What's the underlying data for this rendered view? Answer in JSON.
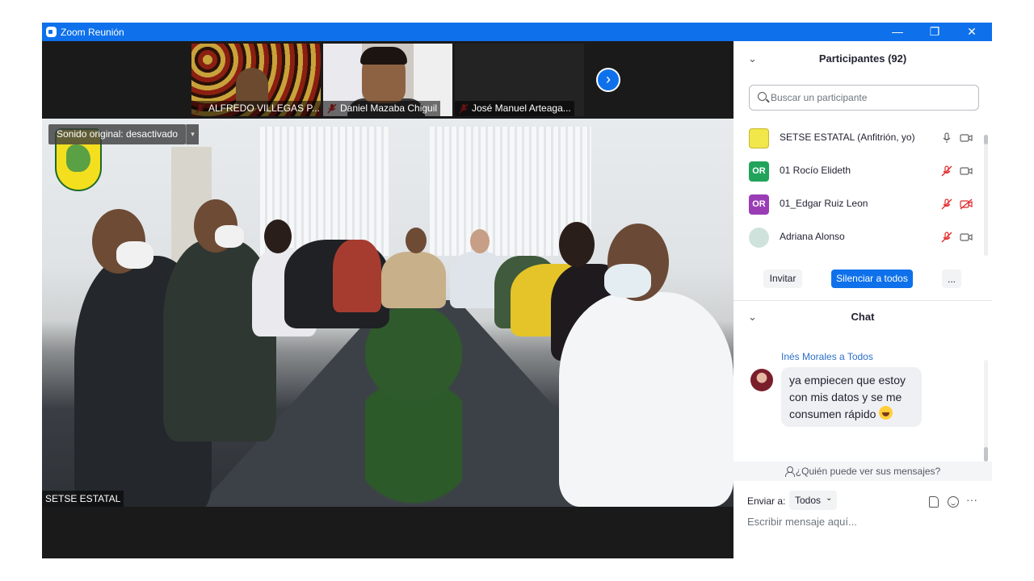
{
  "window": {
    "title": "Zoom Reunión",
    "controls": {
      "minimize": "—",
      "maximize": "❐",
      "close": "✕"
    },
    "accent": "#0e71eb"
  },
  "video_strip": {
    "thumbnails": [
      {
        "name": "ALFREDO VILLEGAS P...",
        "muted": true
      },
      {
        "name": "Daniel Mazaba Chiguil",
        "muted": true
      },
      {
        "name": "José Manuel Arteaga...",
        "muted": true
      }
    ],
    "next_icon": "›"
  },
  "main_video": {
    "audio_badge": "Sonido original: desactivado",
    "dropdown_icon": "▾",
    "speaker_name": "SETSE ESTATAL"
  },
  "participants": {
    "collapse_icon": "⌄",
    "title": "Participantes (92)",
    "search_placeholder": "Buscar un participante",
    "list": [
      {
        "name": "SETSE ESTATAL (Anfitrión, yo)",
        "avatar": "",
        "avatar_color": "#f1e64a",
        "mic": "on",
        "video": "on"
      },
      {
        "name": "01 Rocío Elideth",
        "avatar": "OR",
        "avatar_color": "#22a35c",
        "mic": "muted",
        "video": "on"
      },
      {
        "name": "01_Edgar Ruiz Leon",
        "avatar": "OR",
        "avatar_color": "#9a3db5",
        "mic": "muted",
        "video": "off"
      },
      {
        "name": "Adriana Alonso",
        "avatar": "",
        "avatar_color": "#cfe3dc",
        "mic": "muted",
        "video": "on"
      },
      {
        "name": "",
        "avatar": "",
        "avatar_color": "#9a3db5",
        "mic": "muted",
        "video": "on"
      }
    ],
    "buttons": {
      "invite": "Invitar",
      "mute_all": "Silenciar a todos",
      "more": "..."
    }
  },
  "chat": {
    "collapse_icon": "⌄",
    "title": "Chat",
    "messages": [
      {
        "sender": "Inés Morales a Todos",
        "text": "ya empiecen que estoy con mis datos y se me consumen rápido",
        "emoji": "grinning-face-icon"
      }
    ],
    "privacy_link": "¿Quién puede ver sus mensajes?",
    "send_to_label": "Enviar a:",
    "send_to_value": "Todos",
    "input_placeholder": "Escribir mensaje aquí...",
    "more_icon": "···"
  }
}
